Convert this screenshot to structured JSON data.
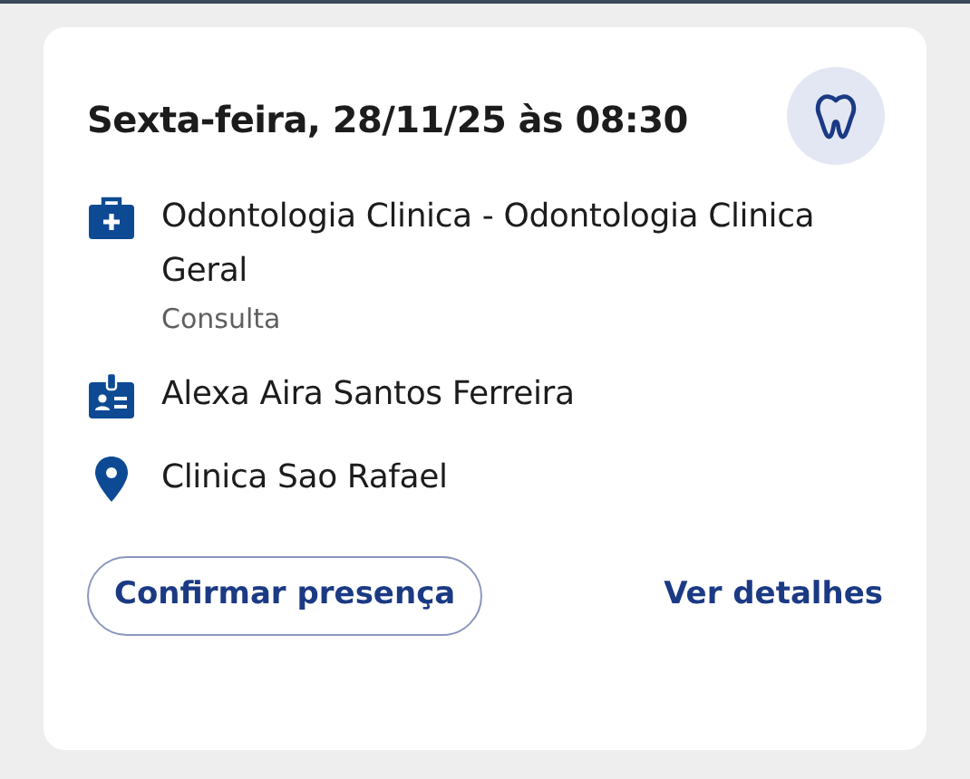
{
  "appointment": {
    "title": "Sexta-feira, 28/11/25 às 08:30",
    "details": [
      {
        "kind": "specialty",
        "text": "Odontologia Clinica - Odontologia Clinica Geral",
        "subtext": "Consulta"
      },
      {
        "kind": "patient",
        "text": "Alexa Aira Santos Ferreira"
      },
      {
        "kind": "location",
        "text": "Clinica Sao Rafael"
      }
    ],
    "buttons": [
      {
        "kind": "outline",
        "label": "Confirmar presença"
      },
      {
        "kind": "link",
        "label": "Ver detalhes"
      }
    ]
  }
}
